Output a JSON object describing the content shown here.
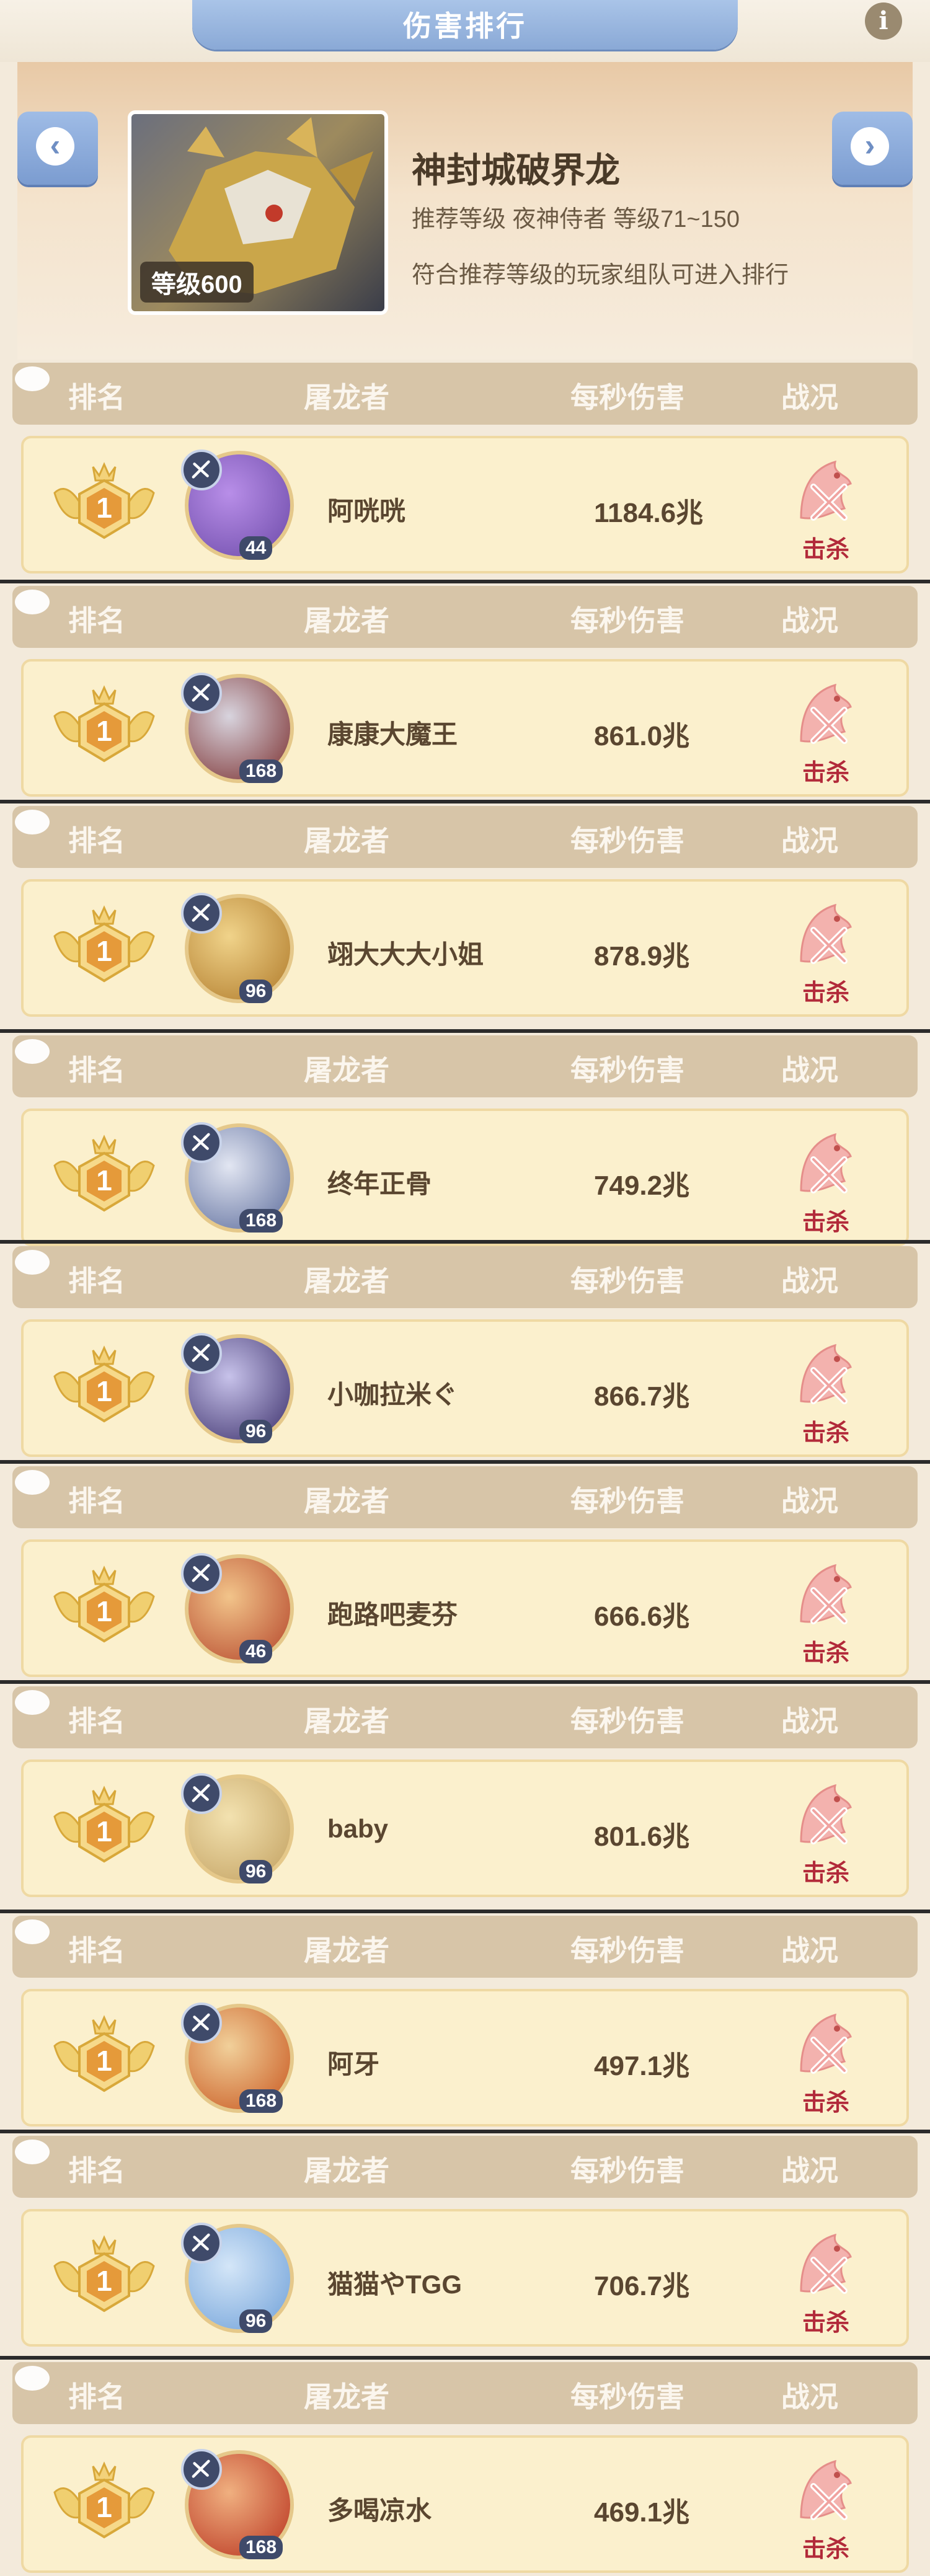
{
  "header": {
    "title": "伤害排行",
    "info_icon": "info-icon"
  },
  "boss": {
    "name": "神封城破界龙",
    "recommend": "推荐等级 夜神侍者  等级71~150",
    "condition": "符合推荐等级的玩家组队可进入排行",
    "level_badge": "等级600"
  },
  "columns": {
    "rank": "排名",
    "player": "屠龙者",
    "dps": "每秒伤害",
    "status": "战况"
  },
  "colors": {
    "accent_blue": "#8aa9d6",
    "row_bg": "#fbf0cd",
    "kill_red": "#b22a3a"
  },
  "rankings": [
    {
      "rank": "1",
      "name": "阿咣咣",
      "level": "44",
      "dps": "1184.6兆",
      "status": "击杀"
    },
    {
      "rank": "1",
      "name": "康康大魔王",
      "level": "168",
      "dps": "861.0兆",
      "status": "击杀"
    },
    {
      "rank": "1",
      "name": "翊大大大小姐",
      "level": "96",
      "dps": "878.9兆",
      "status": "击杀"
    },
    {
      "rank": "1",
      "name": "终年正骨",
      "level": "168",
      "dps": "749.2兆",
      "status": "击杀"
    },
    {
      "rank": "1",
      "name": "小咖拉米ぐ",
      "level": "96",
      "dps": "866.7兆",
      "status": "击杀"
    },
    {
      "rank": "1",
      "name": "跑路吧麦芬",
      "level": "46",
      "dps": "666.6兆",
      "status": "击杀"
    },
    {
      "rank": "1",
      "name": "baby",
      "level": "96",
      "dps": "801.6兆",
      "status": "击杀"
    },
    {
      "rank": "1",
      "name": "阿牙",
      "level": "168",
      "dps": "497.1兆",
      "status": "击杀"
    },
    {
      "rank": "1",
      "name": "猫猫やTGG",
      "level": "96",
      "dps": "706.7兆",
      "status": "击杀"
    },
    {
      "rank": "1",
      "name": "多喝凉水",
      "level": "168",
      "dps": "469.1兆",
      "status": "击杀"
    }
  ]
}
